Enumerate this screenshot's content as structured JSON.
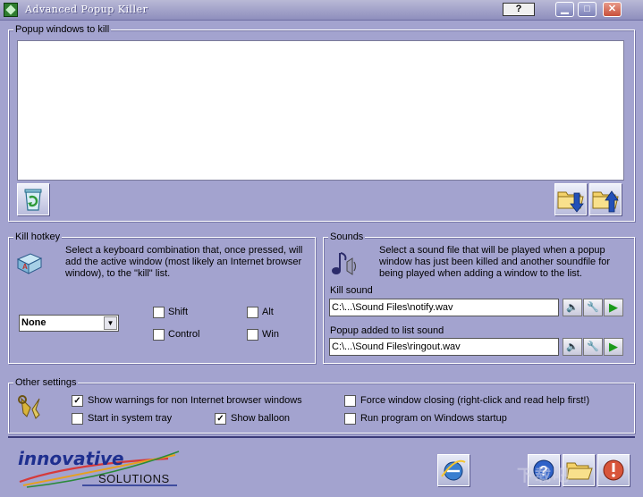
{
  "window": {
    "title": "Advanced Popup Killer",
    "help_label": "?"
  },
  "popups": {
    "legend": "Popup windows to kill",
    "items": []
  },
  "hotkey": {
    "legend": "Kill hotkey",
    "description": "Select a keyboard combination that, once pressed, will add the active window (most likely an Internet browser window), to the \"kill\" list.",
    "key_value": "None",
    "shift_label": "Shift",
    "control_label": "Control",
    "alt_label": "Alt",
    "win_label": "Win"
  },
  "sounds": {
    "legend": "Sounds",
    "description": "Select a sound file that will be played when a popup window has just been killed and another soundfile for being played when adding a window to the list.",
    "kill_label": "Kill sound",
    "kill_value": "C:\\...\\Sound Files\\notify.wav",
    "added_label": "Popup added to list sound",
    "added_value": "C:\\...\\Sound Files\\ringout.wav"
  },
  "other": {
    "legend": "Other settings",
    "show_warnings_label": "Show warnings for non Internet browser windows",
    "start_tray_label": "Start in system tray",
    "show_balloon_label": "Show balloon",
    "force_close_label": "Force window closing (right-click and read help first!)",
    "run_startup_label": "Run program on Windows startup"
  },
  "logo": {
    "line1": "innovative",
    "line2": "SOLUTIONS"
  },
  "watermark": "下载吧"
}
